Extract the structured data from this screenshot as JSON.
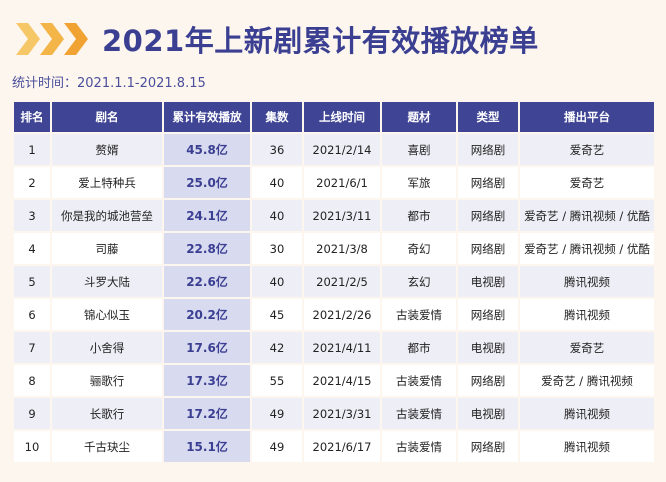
{
  "header": {
    "title": "2021年上新剧累计有效播放榜单",
    "subtitle": "统计时间：2021.1.1-2021.8.15",
    "accent_color": "#3b3f92",
    "chevron_color": "#f3b548"
  },
  "table": {
    "headers": [
      "排名",
      "剧名",
      "累计有效播放",
      "集数",
      "上线时间",
      "题材",
      "类型",
      "播出平台"
    ],
    "rows": [
      [
        "1",
        "赘婿",
        "45.8亿",
        "36",
        "2021/2/14",
        "喜剧",
        "网络剧",
        "爱奇艺"
      ],
      [
        "2",
        "爱上特种兵",
        "25.0亿",
        "40",
        "2021/6/1",
        "军旅",
        "网络剧",
        "爱奇艺"
      ],
      [
        "3",
        "你是我的城池营垒",
        "24.1亿",
        "40",
        "2021/3/11",
        "都市",
        "网络剧",
        "爱奇艺 / 腾讯视频 / 优酷"
      ],
      [
        "4",
        "司藤",
        "22.8亿",
        "30",
        "2021/3/8",
        "奇幻",
        "网络剧",
        "爱奇艺 / 腾讯视频 / 优酷"
      ],
      [
        "5",
        "斗罗大陆",
        "22.6亿",
        "40",
        "2021/2/5",
        "玄幻",
        "电视剧",
        "腾讯视频"
      ],
      [
        "6",
        "锦心似玉",
        "20.2亿",
        "45",
        "2021/2/26",
        "古装爱情",
        "网络剧",
        "腾讯视频"
      ],
      [
        "7",
        "小舍得",
        "17.6亿",
        "42",
        "2021/4/11",
        "都市",
        "电视剧",
        "爱奇艺"
      ],
      [
        "8",
        "骊歌行",
        "17.3亿",
        "55",
        "2021/4/15",
        "古装爱情",
        "网络剧",
        "爱奇艺 / 腾讯视频"
      ],
      [
        "9",
        "长歌行",
        "17.2亿",
        "49",
        "2021/3/31",
        "古装爱情",
        "电视剧",
        "腾讯视频"
      ],
      [
        "10",
        "千古玦尘",
        "15.1亿",
        "49",
        "2021/6/17",
        "古装爱情",
        "网络剧",
        "腾讯视频"
      ]
    ]
  }
}
